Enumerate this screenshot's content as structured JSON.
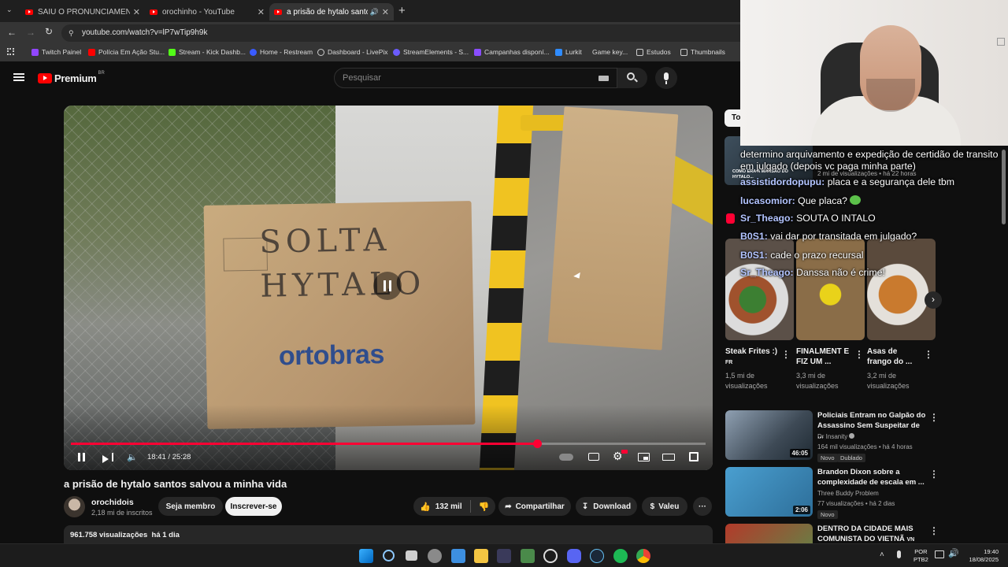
{
  "tabs": [
    {
      "label": "SAIU O PRONUNCIAMENTO K...",
      "active": false
    },
    {
      "label": "orochinho - YouTube",
      "active": false
    },
    {
      "label": "a prisão de hytalo santos sa...",
      "active": true
    }
  ],
  "address_url": "youtube.com/watch?v=lP7wTip9h9k",
  "bookmarks": [
    "Twitch Painel",
    "Polícia Em Ação Stu...",
    "Stream - Kick Dashb...",
    "Home - Restream",
    "Dashboard - LivePix",
    "StreamElements - S...",
    "Campanhas disponí...",
    "Lurkit",
    "Game key...",
    "Estudos",
    "Thumbnails"
  ],
  "header": {
    "logo": "Premium",
    "region": "BR",
    "search_placeholder": "Pesquisar"
  },
  "player": {
    "sign_text": "SOLTA HYTALO",
    "brand_on_box": "ortobras",
    "time": "18:41 / 25:28",
    "progress": 0.734
  },
  "video": {
    "title": "a prisão de hytalo santos salvou a minha vida",
    "channel": "orochidois",
    "subscribers": "2,18 mi de inscritos",
    "join_label": "Seja membro",
    "subscribe_label": "Inscrever-se",
    "likes": "132 mil",
    "share_label": "Compartilhar",
    "download_label": "Download",
    "thanks_label": "Valeu",
    "views_line": "961.758 visualizações  há 1 dia"
  },
  "chips": {
    "first": "To"
  },
  "top_card": {
    "views": "2 mi de visualizações",
    "age": "há 22 horas",
    "thumb_text": "COMO ERA A MANSÃO DO HYTALO..."
  },
  "shorts": [
    {
      "title": "Steak Frites :)",
      "flag": "FR",
      "views": "1,5 mi de visualizações"
    },
    {
      "title": "FINALMENT E FIZ UM ...",
      "flag": "",
      "views": "3,3 mi de visualizações"
    },
    {
      "title": "Asas de frango do ...",
      "flag": "",
      "views": "3,2 mi de visualizações"
    }
  ],
  "recommendations": [
    {
      "title": "Policiais Entram no Galpão do Assassino Sem Suspeitar de ...",
      "channel": "Dr Insanity",
      "verified": true,
      "stats": "164 mil visualizações • há 4 horas",
      "badges": [
        "Novo",
        "Dublado"
      ],
      "duration": "46:05"
    },
    {
      "title": "Brandon Dixon sobre a complexidade de escala em ...",
      "channel": "Three Buddy Problem",
      "verified": false,
      "stats": "77 visualizações • há 2 dias",
      "badges": [
        "Novo"
      ],
      "duration": "2:06"
    },
    {
      "title": "DENTRO DA CIDADE MAIS COMUNISTA DO VIETNÃ",
      "channel": "",
      "verified": false,
      "stats": "",
      "badges": [],
      "duration": "",
      "flag": "VN"
    }
  ],
  "chat": [
    {
      "nick": "",
      "msg": "determino arquivamento e expedição de certidão de transito"
    },
    {
      "nick": "",
      "msg": "em julgado (depois vc paga minha parte)"
    },
    {
      "nick": "assistidordopupu:",
      "msg": "placa e a segurança dele tbm"
    },
    {
      "nick": "lucasomior:",
      "msg": "Que placa?"
    },
    {
      "nick": "Sr_Theago:",
      "msg": "SOUTA O INTALO"
    },
    {
      "nick": "B0S1:",
      "msg": "vai dar por transitada em julgado?"
    },
    {
      "nick": "B0S1:",
      "msg": "cade o prazo recursal"
    },
    {
      "nick": "Sr_Theago:",
      "msg": "Danssa não é crime!"
    }
  ],
  "taskbar": {
    "lang": "POR",
    "layout": "PTB2",
    "time": "19:40",
    "date": "18/08/2025"
  },
  "colors": {
    "accent": "#ff0033",
    "bg": "#0f0f0f",
    "chat_nick": "#b3c4ff"
  }
}
